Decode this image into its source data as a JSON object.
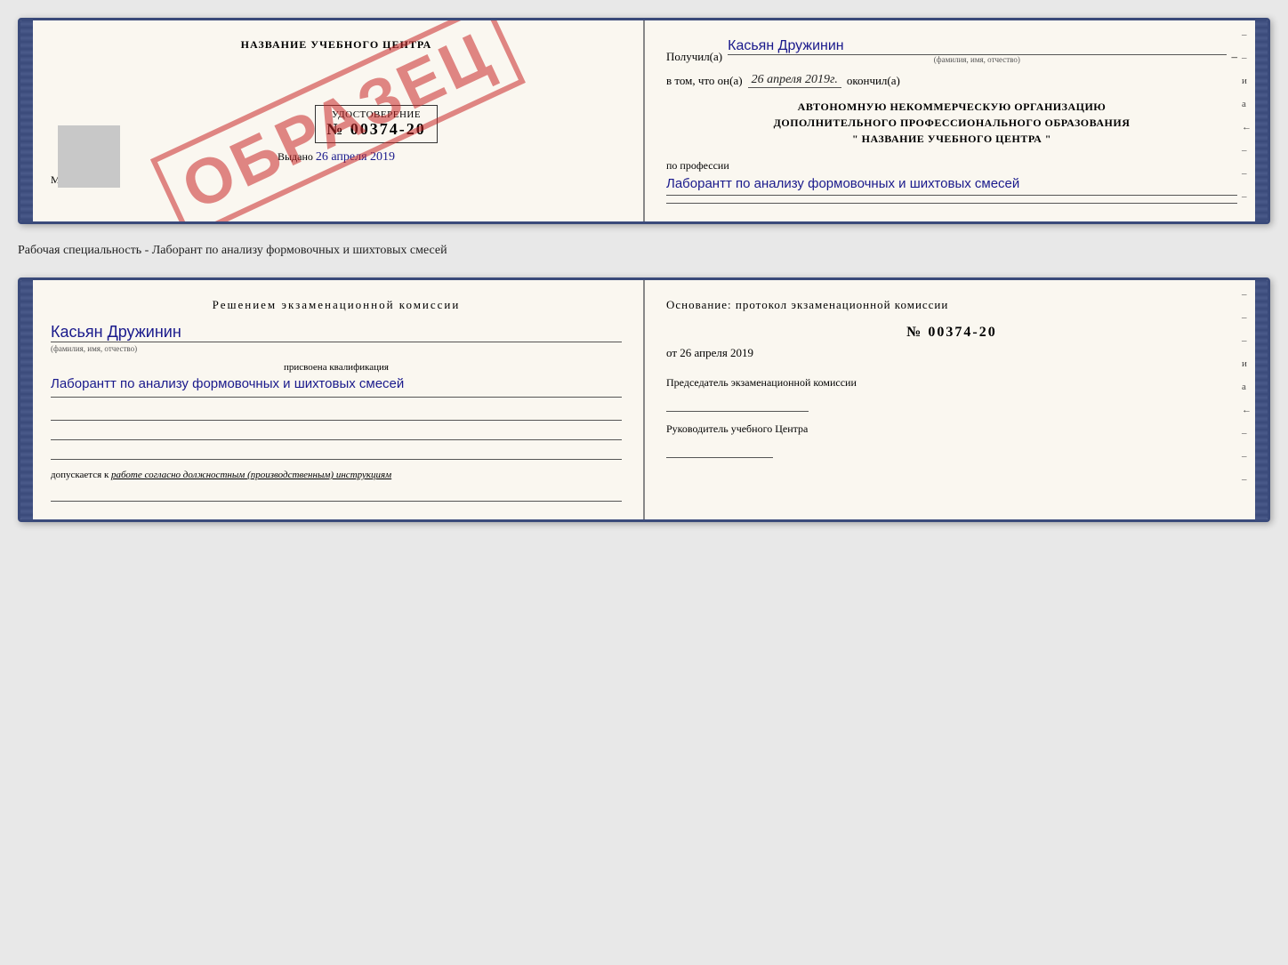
{
  "doc1": {
    "left": {
      "title": "НАЗВАНИЕ УЧЕБНОГО ЦЕНТРА",
      "cert_label": "УДОСТОВЕРЕНИЕ",
      "cert_number": "№ 00374-20",
      "issued_label": "Выдано",
      "issued_date": "26 апреля 2019",
      "mp_label": "М.П.",
      "stamp_text": "ОБРАЗЕЦ",
      "gray_placeholder": true
    },
    "right": {
      "received_label": "Получил(а)",
      "received_name": "Касьян Дружинин",
      "received_sublabel": "(фамилия, имя, отчество)",
      "dash1": "–",
      "in_that_label": "в том, что он(а)",
      "in_that_date": "26 апреля 2019г.",
      "finished_label": "окончил(а)",
      "org_line1": "АВТОНОМНУЮ НЕКОММЕРЧЕСКУЮ ОРГАНИЗАЦИЮ",
      "org_line2": "ДОПОЛНИТЕЛЬНОГО ПРОФЕССИОНАЛЬНОГО ОБРАЗОВАНИЯ",
      "org_line3": "\"  НАЗВАНИЕ УЧЕБНОГО ЦЕНТРА  \"",
      "profession_label": "по профессии",
      "profession_value": "Лаборантт по анализу формовочных и шихтовых смесей",
      "side_items": [
        "–",
        "–",
        "и",
        "а",
        "←",
        "–",
        "–",
        "–"
      ]
    }
  },
  "specialty_text": "Рабочая специальность - Лаборант по анализу формовочных и шихтовых смесей",
  "doc2": {
    "left": {
      "decision_title": "Решением  экзаменационной  комиссии",
      "person_name": "Касьян Дружинин",
      "person_sublabel": "(фамилия, имя, отчество)",
      "qualification_label": "присвоена квалификация",
      "qualification_value": "Лаборантт по анализу формовочных и шихтовых смесей",
      "admits_label": "допускается к",
      "admits_value": "работе согласно должностным (производственным) инструкциям"
    },
    "right": {
      "basis_label": "Основание: протокол экзаменационной  комиссии",
      "basis_number": "№  00374-20",
      "basis_date_prefix": "от",
      "basis_date": "26 апреля 2019",
      "chairman_label": "Председатель экзаменационной комиссии",
      "head_label": "Руководитель учебного Центра",
      "side_items": [
        "–",
        "–",
        "–",
        "и",
        "а",
        "←",
        "–",
        "–",
        "–"
      ]
    }
  }
}
